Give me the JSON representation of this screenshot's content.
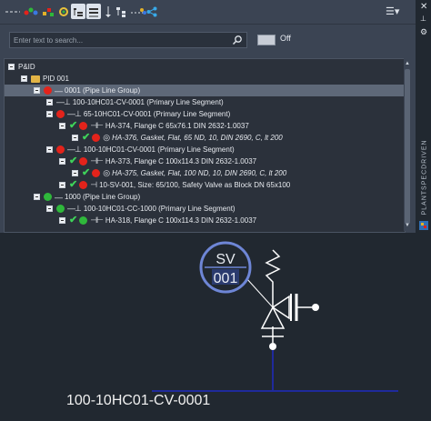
{
  "search": {
    "placeholder": "Enter text to search..."
  },
  "filter": {
    "toggle_label": "Off"
  },
  "sidebar_tab": {
    "label": "PLANTSPECDRIVEN"
  },
  "tree": {
    "root": "P&ID",
    "pid": "PID 001",
    "rows": [
      {
        "text": "0001 (Pipe Line Group)",
        "dot": "red"
      },
      {
        "text": "100-10HC01-CV-0001 (Primary Line Segment)",
        "dot": "red"
      },
      {
        "text": "65-10HC01-CV-0001 (Primary Line Segment)",
        "dot": "red"
      },
      {
        "text": "HA-374, Flange C 65x76.1 DIN 2632-1.0037",
        "dot": "red"
      },
      {
        "text": "HA-376, Gasket, Flat, 65 ND, 10, DIN 2690, C, lt 200",
        "dot": "red"
      },
      {
        "text": "100-10HC01-CV-0001 (Primary Line Segment)",
        "dot": "red"
      },
      {
        "text": "HA-373, Flange C 100x114.3 DIN 2632-1.0037",
        "dot": "red"
      },
      {
        "text": "HA-375, Gasket, Flat, 100 ND, 10, DIN 2690, C, lt 200",
        "dot": "red"
      },
      {
        "text": "10-SV-001, Size: 65/100, Safety Valve as Block DN 65x100",
        "dot": "red"
      },
      {
        "text": "1000 (Pipe Line Group)",
        "dot": "green"
      },
      {
        "text": "100-10HC01-CC-1000 (Primary Line Segment)",
        "dot": "green"
      },
      {
        "text": "HA-318, Flange C 100x114.3 DIN 2632-1.0037",
        "dot": "green"
      }
    ]
  },
  "drawing": {
    "tag_line1": "SV",
    "tag_line2": "001",
    "caption": "100-10HC01-CV-0001",
    "line_color": "#1f2a9c",
    "tag_color": "#6e86d6"
  }
}
